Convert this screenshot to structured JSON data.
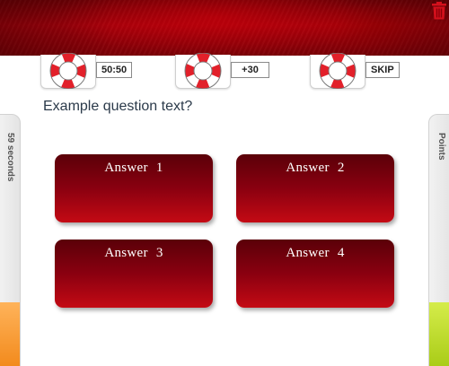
{
  "lifelines": [
    {
      "label": "50:50",
      "icon": "lifebuoy-icon"
    },
    {
      "label": "+30",
      "icon": "lifebuoy-icon"
    },
    {
      "label": "SKIP",
      "icon": "lifebuoy-icon"
    }
  ],
  "question": {
    "text": "Example question text?"
  },
  "timer": {
    "label": "59 seconds"
  },
  "points": {
    "label": "Points"
  },
  "answers": [
    {
      "label": "Answer 1"
    },
    {
      "label": "Answer 2"
    },
    {
      "label": "Answer 3"
    },
    {
      "label": "Answer 4"
    }
  ],
  "colors": {
    "header": "#a4000a",
    "answer_top": "#5a0008",
    "answer_bottom": "#c40a14",
    "timer_fill": "#f28a1c",
    "points_fill": "#a9cc17",
    "trash": "#d4101c"
  }
}
